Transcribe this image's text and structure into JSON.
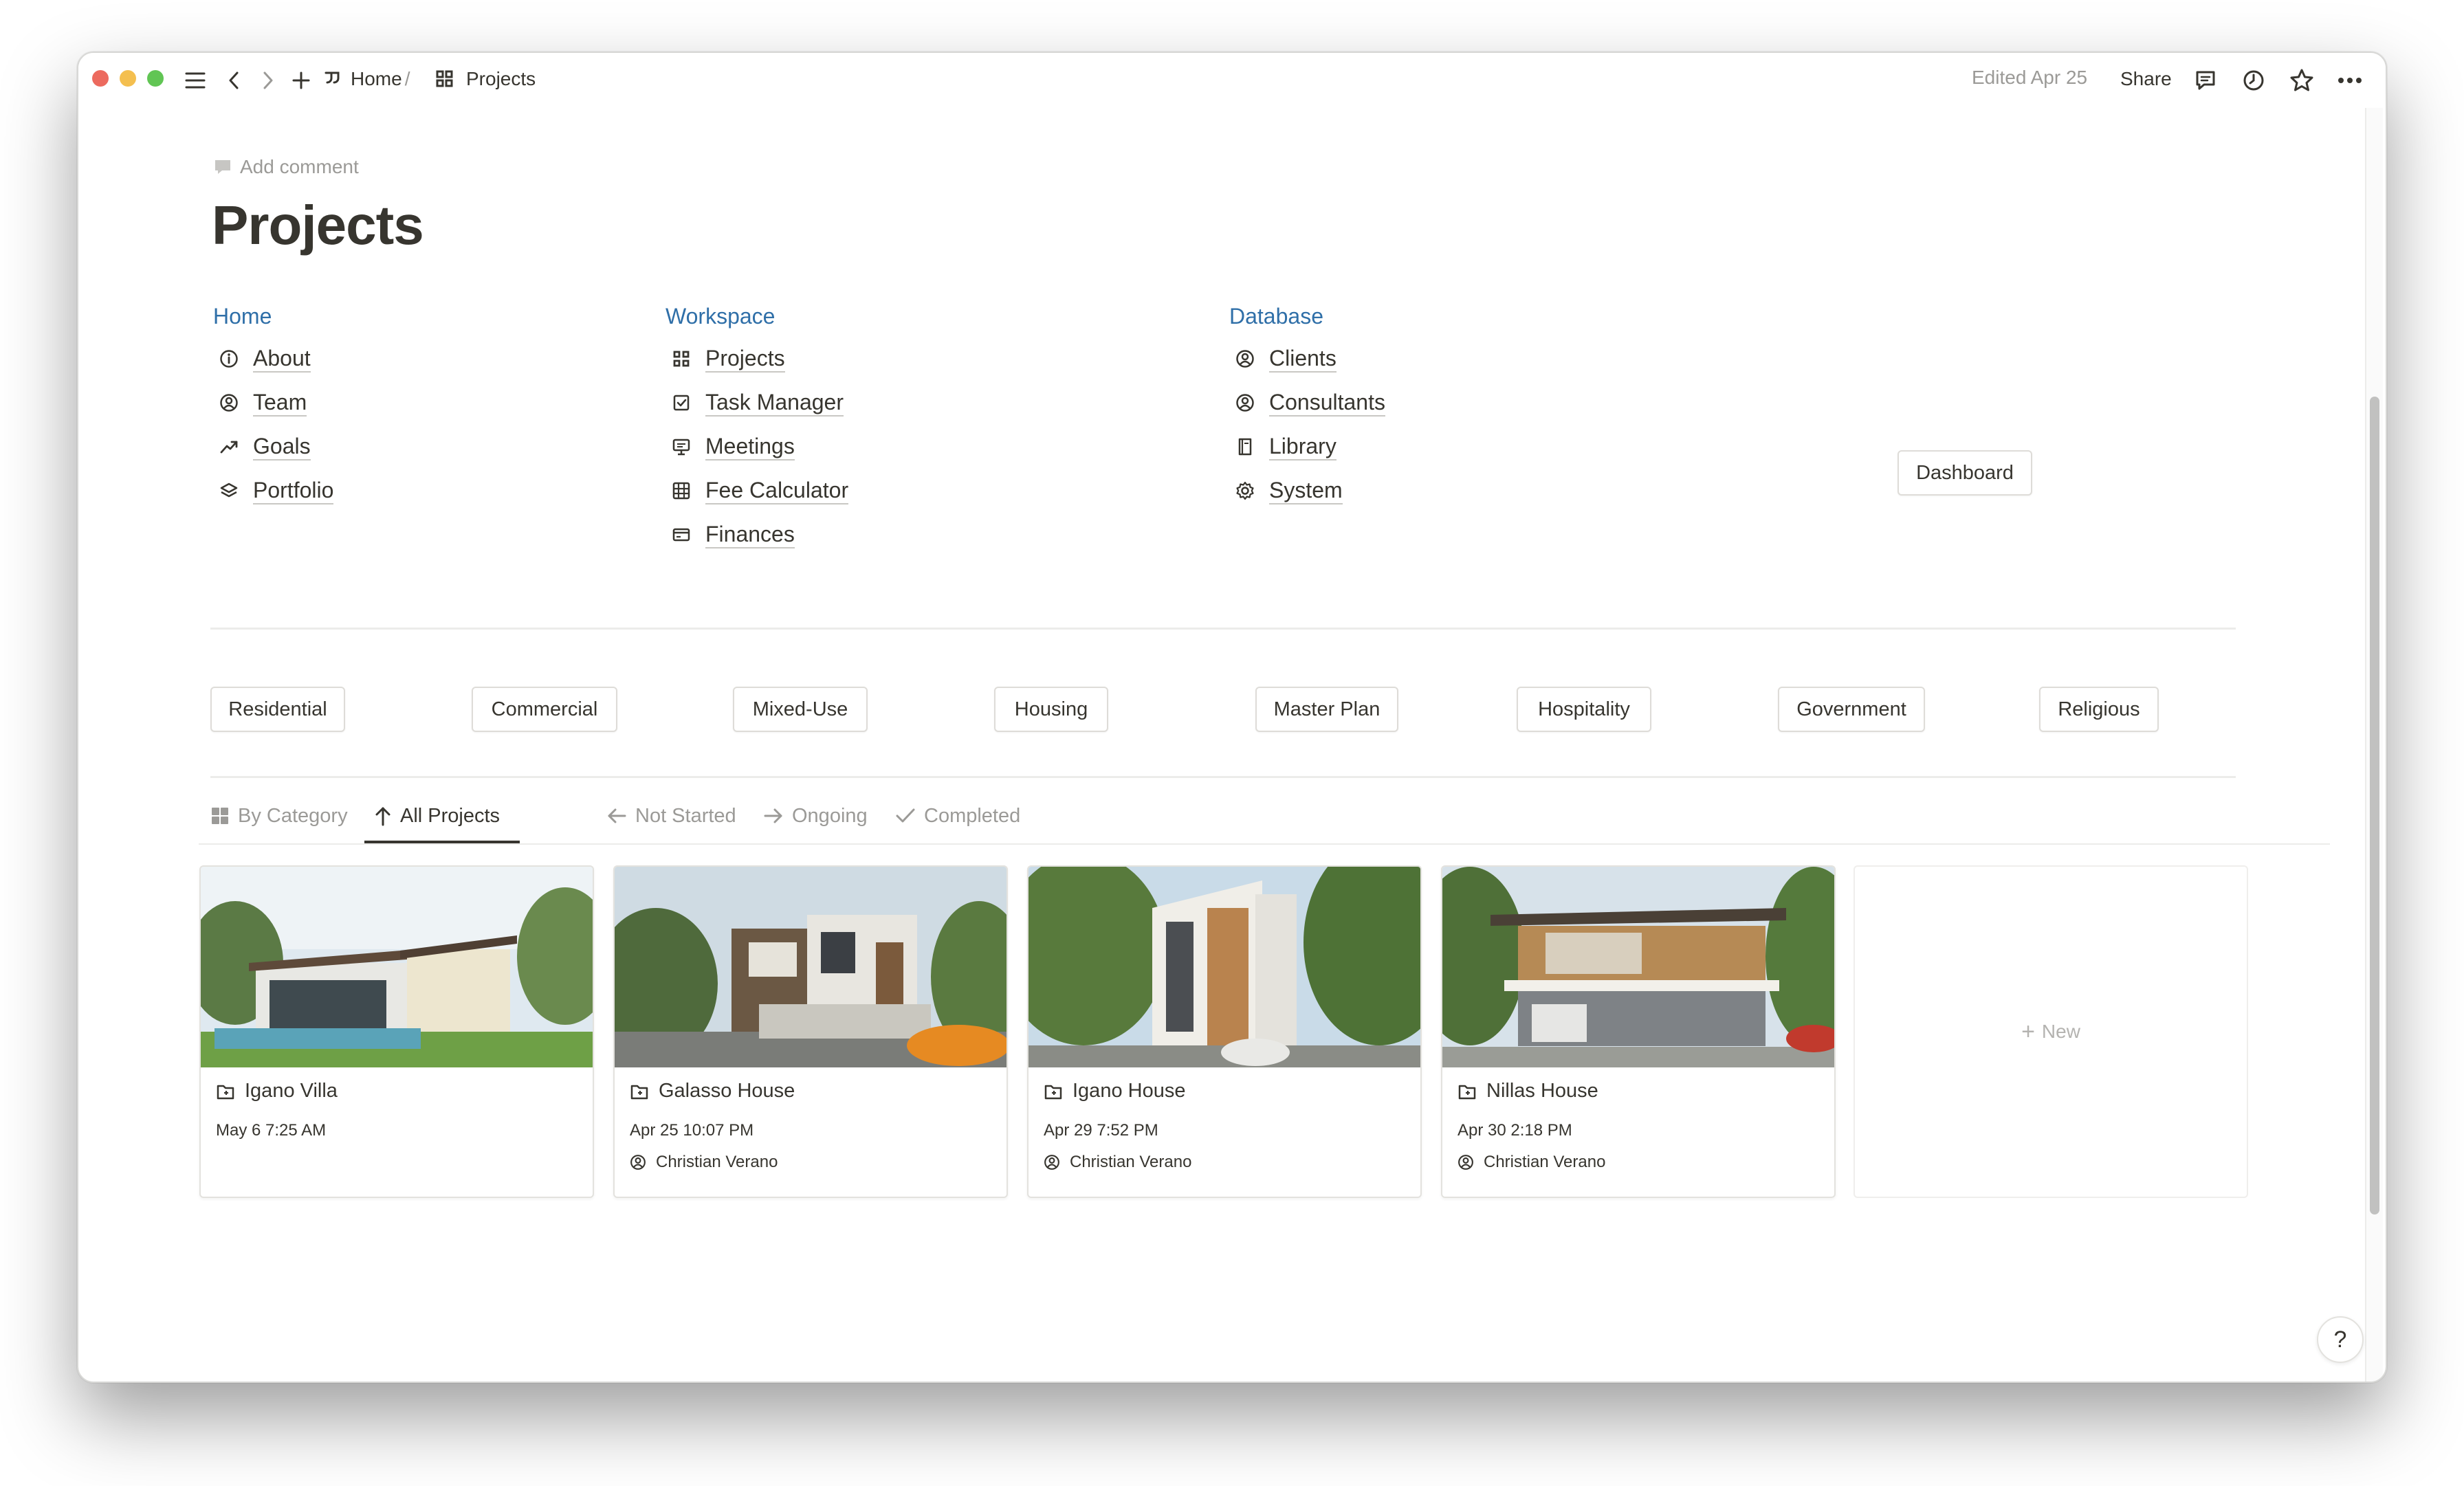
{
  "topbar": {
    "breadcrumb": [
      {
        "label": "Home",
        "sep": "/"
      },
      {
        "label": "Projects"
      }
    ],
    "edited": "Edited Apr 25",
    "share": "Share"
  },
  "page": {
    "add_comment": "Add comment",
    "title": "Projects"
  },
  "nav": {
    "home": {
      "heading": "Home",
      "items": [
        {
          "label": "About",
          "icon": "info-icon"
        },
        {
          "label": "Team",
          "icon": "person-circle-icon"
        },
        {
          "label": "Goals",
          "icon": "trend-up-icon"
        },
        {
          "label": "Portfolio",
          "icon": "layers-icon"
        }
      ]
    },
    "workspace": {
      "heading": "Workspace",
      "items": [
        {
          "label": "Projects",
          "icon": "grid-icon"
        },
        {
          "label": "Task Manager",
          "icon": "checkbox-icon"
        },
        {
          "label": "Meetings",
          "icon": "presentation-icon"
        },
        {
          "label": "Fee Calculator",
          "icon": "calculator-icon"
        },
        {
          "label": "Finances",
          "icon": "card-icon"
        }
      ]
    },
    "database": {
      "heading": "Database",
      "items": [
        {
          "label": "Clients",
          "icon": "person-circle-icon"
        },
        {
          "label": "Consultants",
          "icon": "person-circle-icon"
        },
        {
          "label": "Library",
          "icon": "book-icon"
        },
        {
          "label": "System",
          "icon": "gear-icon"
        }
      ]
    },
    "dashboard_button": "Dashboard"
  },
  "categories": [
    "Residential",
    "Commercial",
    "Mixed-Use",
    "Housing",
    "Master Plan",
    "Hospitality",
    "Government",
    "Religious"
  ],
  "views": {
    "tabs": [
      {
        "label": "By Category",
        "icon": "grid-icon"
      },
      {
        "label": "All Projects",
        "icon": "arrow-up-icon"
      },
      {
        "label": "Not Started",
        "icon": "arrow-left-icon"
      },
      {
        "label": "Ongoing",
        "icon": "arrow-right-icon"
      },
      {
        "label": "Completed",
        "icon": "check-icon"
      }
    ],
    "active_tab": "All Projects"
  },
  "cards": [
    {
      "title": "Igano Villa",
      "date": "May 6 7:25 AM",
      "person": ""
    },
    {
      "title": "Galasso House",
      "date": "Apr 25 10:07 PM",
      "person": "Christian Verano"
    },
    {
      "title": "Igano House",
      "date": "Apr 29 7:52 PM",
      "person": "Christian Verano"
    },
    {
      "title": "Nillas House",
      "date": "Apr 30 2:18 PM",
      "person": "Christian Verano"
    }
  ],
  "new_card": "New",
  "help": "?",
  "colors": {
    "accent_link": "#2f6fa8",
    "text": "#37352f",
    "muted": "#9b9a97"
  }
}
